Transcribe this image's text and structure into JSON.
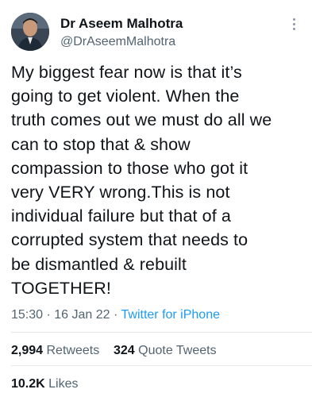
{
  "author": {
    "name": "Dr Aseem Malhotra",
    "handle": "@DrAseemMalhotra"
  },
  "tweet": {
    "text": "My biggest fear now is that it’s\ngoing to get violent. When the\ntruth comes out we must do all we\ncan to stop that & show\ncompassion to those who got it\nvery VERY wrong.This is not\nindividual failure but that of a\ncorrupted system that needs to\nbe dismantled & rebuilt\nTOGETHER!",
    "time": "15:30",
    "date": "16 Jan 22",
    "source": "Twitter for iPhone"
  },
  "stats": {
    "retweets_count": "2,994",
    "retweets_label": "Retweets",
    "quotes_count": "324",
    "quotes_label": "Quote Tweets",
    "likes_count": "10.2K",
    "likes_label": "Likes"
  },
  "icons": {
    "more": "more-vertical-icon",
    "avatar": "profile-photo"
  },
  "colors": {
    "text": "#0f1419",
    "secondary": "#536471",
    "link": "#1d9bf0",
    "divider": "#e4e8eb"
  }
}
